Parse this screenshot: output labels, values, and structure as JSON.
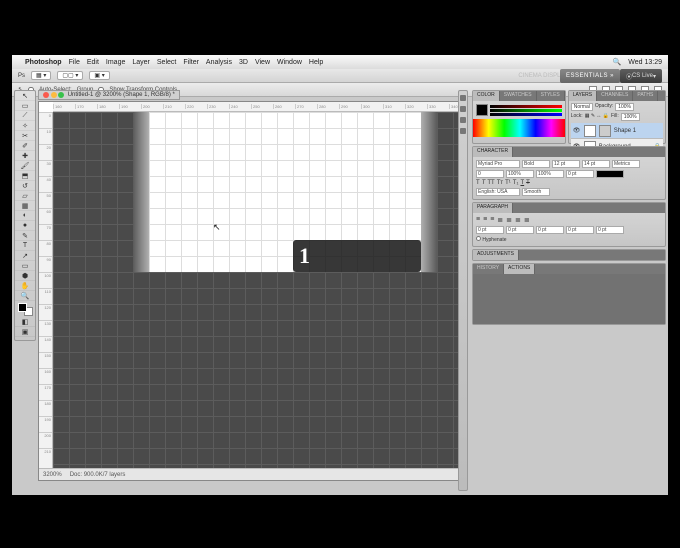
{
  "osx": {
    "app": "Photoshop",
    "menus": [
      "File",
      "Edit",
      "Image",
      "Layer",
      "Select",
      "Filter",
      "Analysis",
      "3D",
      "View",
      "Window",
      "Help"
    ],
    "clock": "Wed 13:29"
  },
  "topright": {
    "cinema": "CINEMA DISPLAY",
    "essentials": "ESSENTIALS",
    "cslive": "CS Live"
  },
  "optbar": {
    "label1": "Auto-Select:",
    "dropdown": "Group",
    "label2": "Show Transform Controls"
  },
  "tab": {
    "title": "Untitled-1 @ 3200% (Shape 1, RGB/8) *"
  },
  "overlay": {
    "value": "1"
  },
  "status": {
    "zoom": "3200%",
    "info": "Doc: 900.0K/7 layers"
  },
  "layers": {
    "mode": "Normal",
    "opacity_label": "Opacity:",
    "opacity": "100%",
    "lock_label": "Lock:",
    "fill_label": "Fill:",
    "fill": "100%",
    "items": [
      {
        "name": "Shape 1",
        "selected": true
      },
      {
        "name": "Background",
        "selected": false
      }
    ]
  },
  "panels": {
    "color_tabs": [
      "COLOR",
      "SWATCHES",
      "STYLES"
    ],
    "layer_tabs": [
      "LAYERS",
      "CHANNELS",
      "PATHS"
    ],
    "char_tabs": [
      "CHARACTER"
    ],
    "para_tabs": [
      "PARAGRAPH"
    ],
    "adjust_tabs": [
      "ADJUSTMENTS"
    ],
    "actions_tabs": [
      "HISTORY",
      "ACTIONS"
    ]
  },
  "character": {
    "font": "Myriad Pro",
    "style": "Bold",
    "size": "12 pt",
    "leading": "14 pt",
    "tracking": "0",
    "kerning": "Metrics",
    "lang": "English: USA",
    "aa": "Smooth"
  },
  "paragraph": {
    "hyphenate": "Hyphenate"
  },
  "tools": [
    "↖",
    "▭",
    "⟋",
    "✎",
    "⌶",
    "◐",
    "✂",
    "✚",
    "⬒",
    "T",
    "↗",
    "◯",
    "✋",
    "🔍",
    "⋯"
  ]
}
